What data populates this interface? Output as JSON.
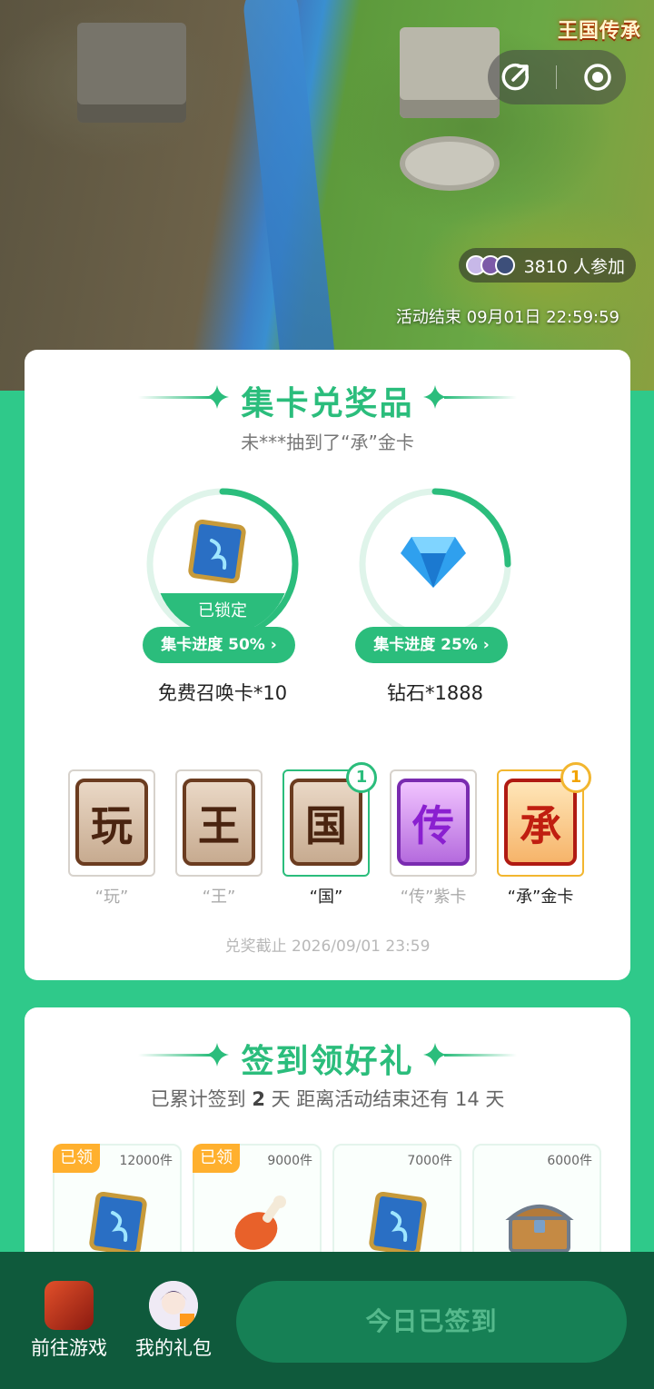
{
  "hero": {
    "logo": "王国传承",
    "participants": "3810 人参加",
    "end_time": "活动结束 09月01日 22:59:59"
  },
  "collect": {
    "title": "集卡兑奖品",
    "broadcast": "未***抽到了“承”金卡",
    "rewards": [
      {
        "name": "免费召唤卡*10",
        "progress_label": "集卡进度 50%",
        "progress": 0.5,
        "locked_label": "已锁定"
      },
      {
        "name": "钻石*1888",
        "progress_label": "集卡进度 25%",
        "progress": 0.25
      }
    ],
    "cards": [
      {
        "char": "玩",
        "label": "“玩”",
        "owned": 0
      },
      {
        "char": "王",
        "label": "“王”",
        "owned": 0
      },
      {
        "char": "国",
        "label": "“国”",
        "owned": 1,
        "badge": "1"
      },
      {
        "char": "传",
        "label": "“传”紫卡",
        "owned": 0
      },
      {
        "char": "承",
        "label": "“承”金卡",
        "owned": 1,
        "badge": "1"
      }
    ],
    "deadline": "兑奖截止 2026/09/01 23:59"
  },
  "signin": {
    "title": "签到领好礼",
    "summary_prefix": "已累计签到 ",
    "days": "2",
    "summary_suffix": " 天  距离活动结束还有 14 天",
    "tiles": [
      {
        "qty": "12000件",
        "claimed": "已领",
        "icon": "summon-card-icon"
      },
      {
        "qty": "9000件",
        "claimed": "已领",
        "icon": "meat-icon"
      },
      {
        "qty": "7000件",
        "icon": "summon-card-icon"
      },
      {
        "qty": "6000件",
        "icon": "treasure-chest-icon"
      }
    ]
  },
  "bottom": {
    "go_game": "前往游戏",
    "my_gifts": "我的礼包",
    "signed_button": "今日已签到"
  },
  "colors": {
    "accent": "#2bbd7c",
    "page_bg": "#2fc98a",
    "bar_bg": "#0f5a3c"
  }
}
